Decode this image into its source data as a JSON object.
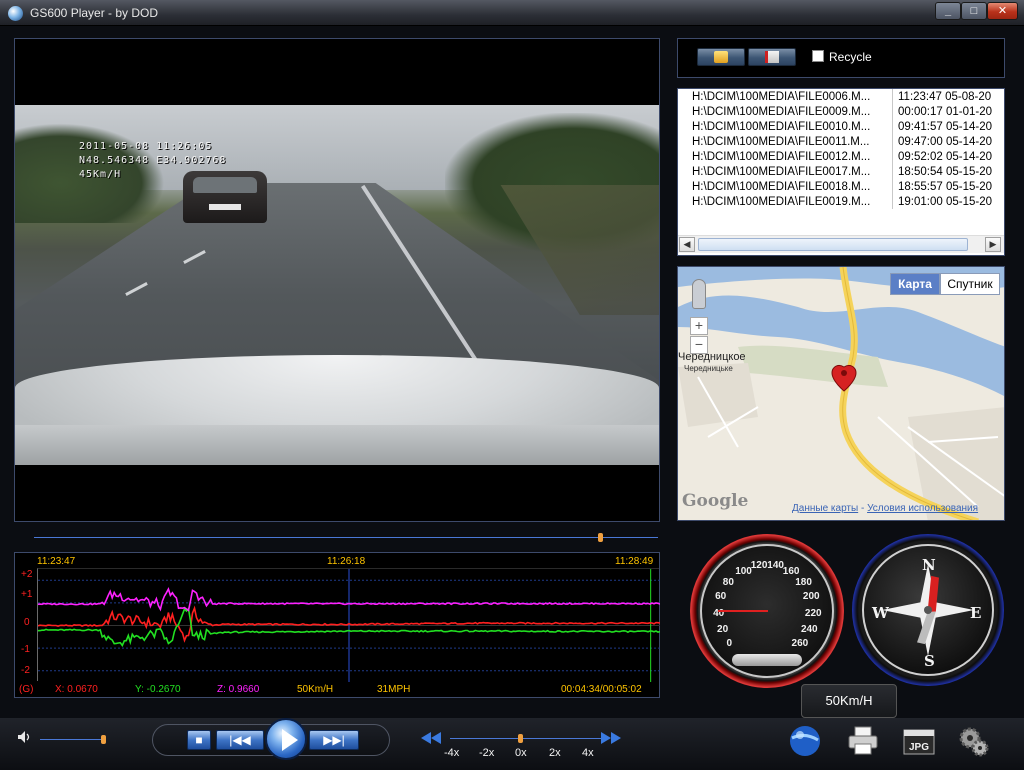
{
  "window": {
    "title": "GS600 Player - by DOD",
    "min": "_",
    "max": "□",
    "close": "✕"
  },
  "video": {
    "osd_line1": "2011-05-08 11:26:05",
    "osd_line2": "N48.546348 E34.902768",
    "osd_line3": "45Km/H"
  },
  "seek": {
    "progress": 0.907
  },
  "toolbar": {
    "recycle_label": "Recycle"
  },
  "files": [
    {
      "name": "H:\\DCIM\\100MEDIA\\FILE0006.M...",
      "time": "11:23:47 05-08-20"
    },
    {
      "name": "H:\\DCIM\\100MEDIA\\FILE0009.M...",
      "time": "00:00:17 01-01-20"
    },
    {
      "name": "H:\\DCIM\\100MEDIA\\FILE0010.M...",
      "time": "09:41:57 05-14-20"
    },
    {
      "name": "H:\\DCIM\\100MEDIA\\FILE0011.M...",
      "time": "09:47:00 05-14-20"
    },
    {
      "name": "H:\\DCIM\\100MEDIA\\FILE0012.M...",
      "time": "09:52:02 05-14-20"
    },
    {
      "name": "H:\\DCIM\\100MEDIA\\FILE0017.M...",
      "time": "18:50:54 05-15-20"
    },
    {
      "name": "H:\\DCIM\\100MEDIA\\FILE0018.M...",
      "time": "18:55:57 05-15-20"
    },
    {
      "name": "H:\\DCIM\\100MEDIA\\FILE0019.M...",
      "time": "19:01:00 05-15-20"
    }
  ],
  "map": {
    "btn_map": "Карта",
    "btn_satellite": "Спутник",
    "place_1": "Чередницкое",
    "place_1_ua": "Чередницьке",
    "logo": "Google",
    "credit_data": "Данные карты",
    "credit_sep": " - ",
    "credit_terms": "Условия использования",
    "zoom_in": "+",
    "zoom_out": "−"
  },
  "graph": {
    "time_start": "11:23:47",
    "time_mid": "11:26:18",
    "time_end": "11:28:49",
    "y_ticks": [
      "+2",
      "+1",
      "0",
      "-1",
      "-2"
    ],
    "g_label": "(G)",
    "x_value": "X: 0.0670",
    "y_value": "Y: -0.2670",
    "z_value": "Z: 0.9660",
    "speed_kmh": "50Km/H",
    "speed_mph": "31MPH",
    "position": "00:04:34/00:05:02",
    "colors": {
      "x": "#ff2020",
      "y": "#22e022",
      "z": "#ff22ff"
    }
  },
  "chart_data": {
    "type": "line",
    "title": "",
    "xlabel": "",
    "ylabel": "",
    "ylim": [
      -2.5,
      2.5
    ],
    "x": [
      0,
      0.1,
      0.12,
      0.2,
      0.21,
      0.24,
      0.25,
      0.27,
      0.3,
      0.5,
      0.7,
      1.0
    ],
    "series": [
      {
        "name": "X: 0.0670",
        "color": "#ff2020",
        "values": [
          0.0,
          0.0,
          0.4,
          0.0,
          0.5,
          -0.6,
          0.6,
          0.0,
          0.05,
          0.05,
          0.1,
          0.1
        ]
      },
      {
        "name": "Y: -0.2670",
        "color": "#22e022",
        "values": [
          -0.2,
          -0.2,
          -0.8,
          -0.3,
          -0.9,
          0.8,
          -0.5,
          -0.4,
          -0.3,
          -0.25,
          -0.25,
          -0.27
        ]
      },
      {
        "name": "Z: 0.9660",
        "color": "#ff22ff",
        "values": [
          0.95,
          0.95,
          1.4,
          0.9,
          1.5,
          0.5,
          1.6,
          0.95,
          0.97,
          0.96,
          0.97,
          0.97
        ]
      }
    ]
  },
  "speedometer": {
    "ticks": [
      "0",
      "20",
      "40",
      "60",
      "80",
      "100",
      "120",
      "140",
      "160",
      "180",
      "200",
      "220",
      "240",
      "260"
    ]
  },
  "compass": {
    "n": "N",
    "s": "S",
    "e": "E",
    "w": "W"
  },
  "speed_box": "50Km/H",
  "controls": {
    "stop": "■",
    "prev": "|◀◀",
    "next": "▶▶|",
    "rates": [
      "-4x",
      "-2x",
      "0x",
      "2x",
      "4x"
    ],
    "volume": 0.95
  }
}
